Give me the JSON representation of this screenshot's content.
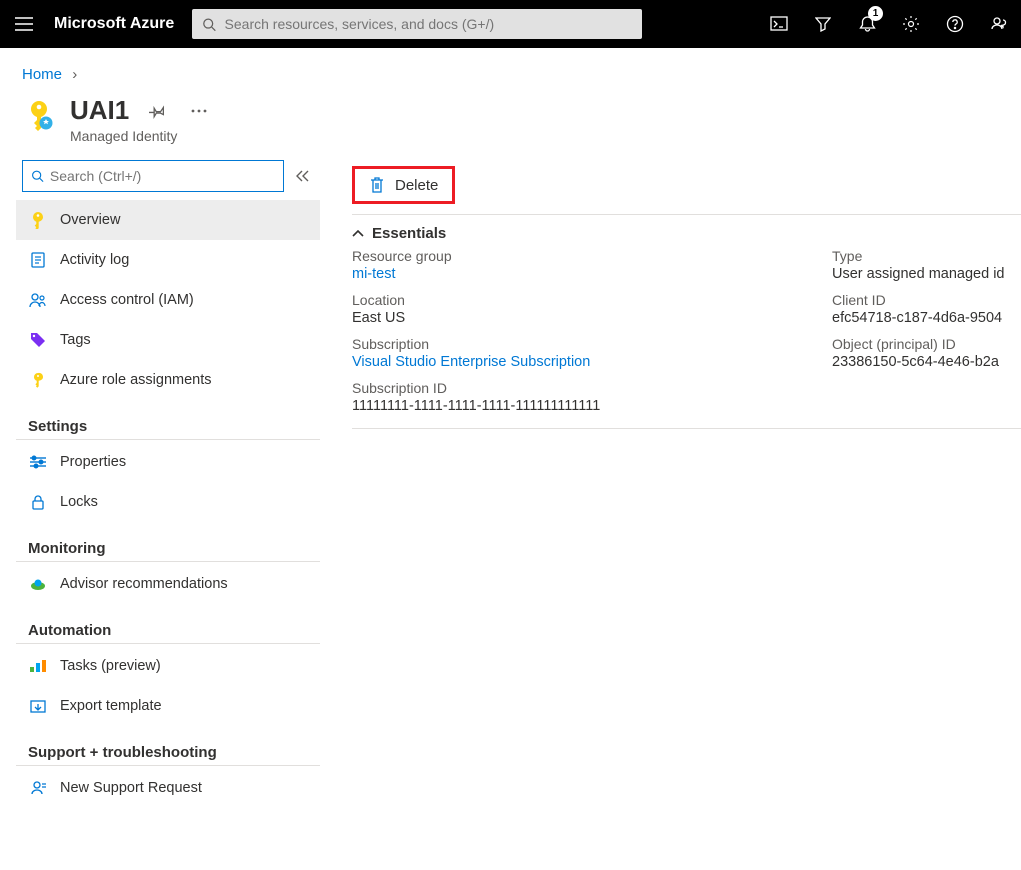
{
  "topbar": {
    "brand": "Microsoft Azure",
    "search_placeholder": "Search resources, services, and docs (G+/)",
    "notification_badge": "1"
  },
  "breadcrumb": {
    "home": "Home"
  },
  "header": {
    "title": "UAI1",
    "subtitle": "Managed Identity"
  },
  "sidebar": {
    "search_placeholder": "Search (Ctrl+/)",
    "items": {
      "overview": "Overview",
      "activity_log": "Activity log",
      "access_control": "Access control (IAM)",
      "tags": "Tags",
      "azure_role_assignments": "Azure role assignments"
    },
    "sections": {
      "settings": "Settings",
      "monitoring": "Monitoring",
      "automation": "Automation",
      "support": "Support + troubleshooting"
    },
    "settings_items": {
      "properties": "Properties",
      "locks": "Locks"
    },
    "monitoring_items": {
      "advisor": "Advisor recommendations"
    },
    "automation_items": {
      "tasks": "Tasks (preview)",
      "export_template": "Export template"
    },
    "support_items": {
      "new_support": "New Support Request"
    }
  },
  "actions": {
    "delete": "Delete"
  },
  "essentials": {
    "title": "Essentials",
    "resource_group_label": "Resource group",
    "resource_group": "mi-test",
    "type_label": "Type",
    "type": "User assigned managed id",
    "location_label": "Location",
    "location": "East US",
    "client_id_label": "Client ID",
    "client_id": "efc54718-c187-4d6a-9504",
    "subscription_label": "Subscription",
    "subscription": "Visual Studio Enterprise Subscription",
    "object_id_label": "Object (principal) ID",
    "object_id": "23386150-5c64-4e46-b2a",
    "subscription_id_label": "Subscription ID",
    "subscription_id": "11111111-1111-1111-1111-111111111111"
  }
}
